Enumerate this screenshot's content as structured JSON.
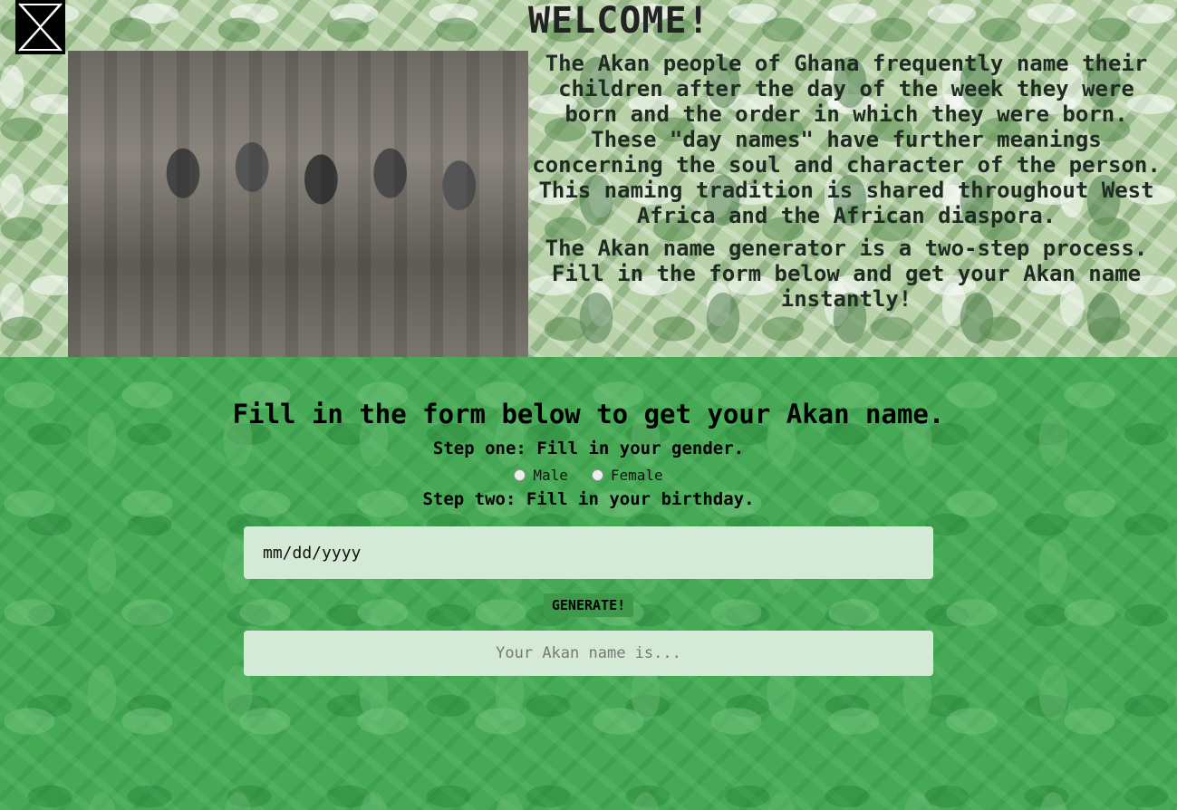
{
  "header": {
    "welcome": "WELCOME!",
    "intro_p1": "The Akan people of Ghana frequently name their children after the day of the week they were born and the order in which they were born. These \"day names\" have further meanings concerning the soul and character of the person. This naming tradition is shared throughout West Africa and the African diaspora.",
    "intro_p2": "The Akan name generator is a two-step process. Fill in the form below and get your Akan name instantly!",
    "logo_icon": "maltese-cross-icon"
  },
  "form": {
    "title": "Fill in the form below to get your Akan name.",
    "step_one": "Step one: Fill in your gender.",
    "gender_options": [
      "Male",
      "Female"
    ],
    "step_two": "Step two: Fill in your birthday.",
    "date_placeholder": "mm/dd/yyyy",
    "generate_label": "GENERATE!",
    "result_placeholder": "Your Akan name is..."
  }
}
